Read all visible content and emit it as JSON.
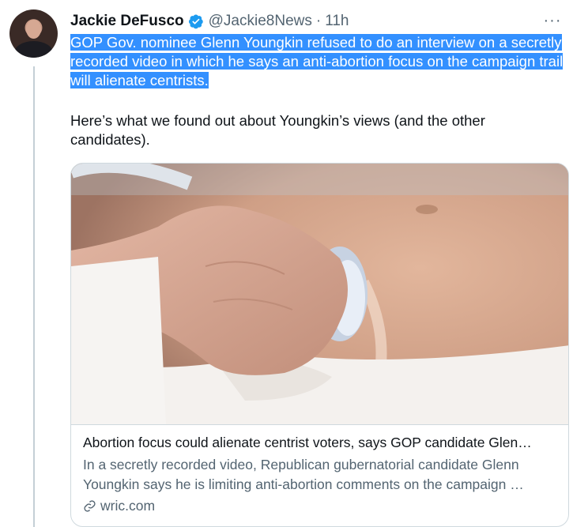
{
  "tweet": {
    "author_name": "Jackie DeFusco",
    "handle": "@Jackie8News",
    "separator": "·",
    "time": "11h",
    "more_label": "···",
    "text_highlighted": "GOP Gov. nominee Glenn Youngkin refused to do an interview on a secretly recorded video in which he says an anti-abortion focus on the campaign trail will alienate centrists.",
    "text_second": "Here’s what we found out about Youngkin’s views (and the other candidates).",
    "verified_icon": "verified-badge-icon",
    "accent_color": "#1d9bf0",
    "selection_color": "#3390ff"
  },
  "card": {
    "image_icon": "ultrasound-photo",
    "title": "Abortion focus could alienate centrist voters, says GOP candidate Glen…",
    "description": "In a secretly recorded video, Republican gubernatorial candidate Glenn Youngkin says he is limiting anti-abortion comments on the campaign …",
    "domain": "wric.com",
    "link_icon": "link-icon"
  }
}
